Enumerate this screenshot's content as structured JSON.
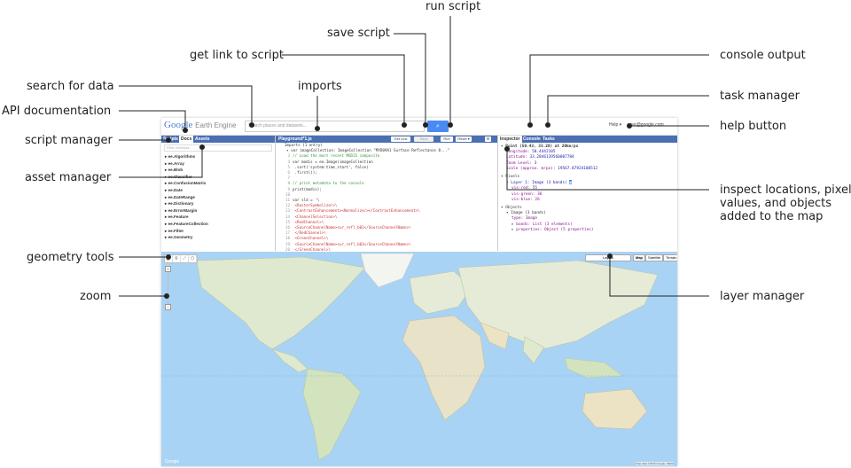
{
  "callouts": {
    "run_script": "run script",
    "save_script": "save script",
    "get_link": "get link to script",
    "console_output": "console output",
    "search_for_data": "search for data",
    "imports": "imports",
    "task_manager": "task manager",
    "api_docs": "API documentation",
    "help_button": "help button",
    "script_manager": "script manager",
    "asset_manager": "asset manager",
    "inspect": "inspect locations, pixel values, and objects added to the map",
    "geometry_tools": "geometry tools",
    "zoom": "zoom",
    "layer_manager": "layer manager"
  },
  "app": {
    "logo_google": "Google",
    "logo_product": "Earth Engine",
    "search_placeholder": "Search places and datasets...",
    "help": "Help ▾",
    "user": "user@google.com",
    "left_tabs": [
      "Scripts",
      "Docs",
      "Assets"
    ],
    "filter_placeholder": "Filter methods...",
    "docs": [
      "ee.Algorithms",
      "ee.Array",
      "ee.Blob",
      "ee.Classifier",
      "ee.ConfusionMatrix",
      "ee.Date",
      "ee.DateRange",
      "ee.Dictionary",
      "ee.ErrorMargin",
      "ee.Feature",
      "ee.FeatureCollection",
      "ee.Filter",
      "ee.Geometry"
    ],
    "editor_title": "Playground*1.js",
    "editor_buttons": {
      "get_link": "Get Link",
      "save": "Save",
      "run": "Run",
      "reset": "Reset ▾"
    },
    "right_tabs": [
      "Inspector",
      "Console",
      "Tasks"
    ],
    "imports_header": "Imports (1 entry)",
    "imports_line": "var imageCollection: ImageCollection \"MYD09A1 Surface Reflectance 8...\"",
    "code": [
      "// Load the most recent MODIS composite",
      "var modis = ee.Image(imageCollection",
      "    .sort('system:time_start', false)",
      "    .first());",
      "",
      "// print metadata to the console",
      "print(modis);",
      "",
      "var sld = '\\",
      "  <RasterSymbolizer>\\",
      "    <ContrastEnhancement><Normalize/></ContrastEnhancement>\\",
      "    <ChannelSelection>\\",
      "      <RedChannel>\\",
      "        <SourceChannelName>sur_refl_b01</SourceChannelName>\\",
      "      </RedChannel>\\",
      "      <GreenChannel>\\",
      "        <SourceChannelName>sur_refl_b03</SourceChannelName>\\",
      "      </GreenChannel>\\",
      "      <BlueChannel>\\",
      "        <SourceChannelName>sur_refl_b03</SourceChannelName>\\"
    ],
    "inspector": {
      "point": "Point (50.43, 33.28) at 20km/px",
      "longitude_k": "Longitude:",
      "longitude_v": "50.4442105",
      "latitude_k": "Latitude:",
      "latitude_v": "33.2846139560007784",
      "zoom_k": "Zoom Level:",
      "zoom_v": "3",
      "scale_k": "Scale (approx. m/px):",
      "scale_v": "19567.87924100512",
      "pixels": "Pixels",
      "layer": "Layer 1: Image (3 bands)",
      "vis_red": "vis-red: 55",
      "vis_green": "vis-green: 36",
      "vis_blue": "vis-blue: 26",
      "objects": "Objects",
      "image": "Image (3 bands)",
      "type": "type: Image",
      "bands": "bands: List (3 elements)",
      "properties": "properties: Object (5 properties)"
    },
    "map": {
      "layers": "Layers",
      "map_types": [
        "Map",
        "Satellite",
        "Terrain"
      ],
      "attribution": "Map data ©2016 Google, INEGI",
      "google": "Google"
    }
  }
}
